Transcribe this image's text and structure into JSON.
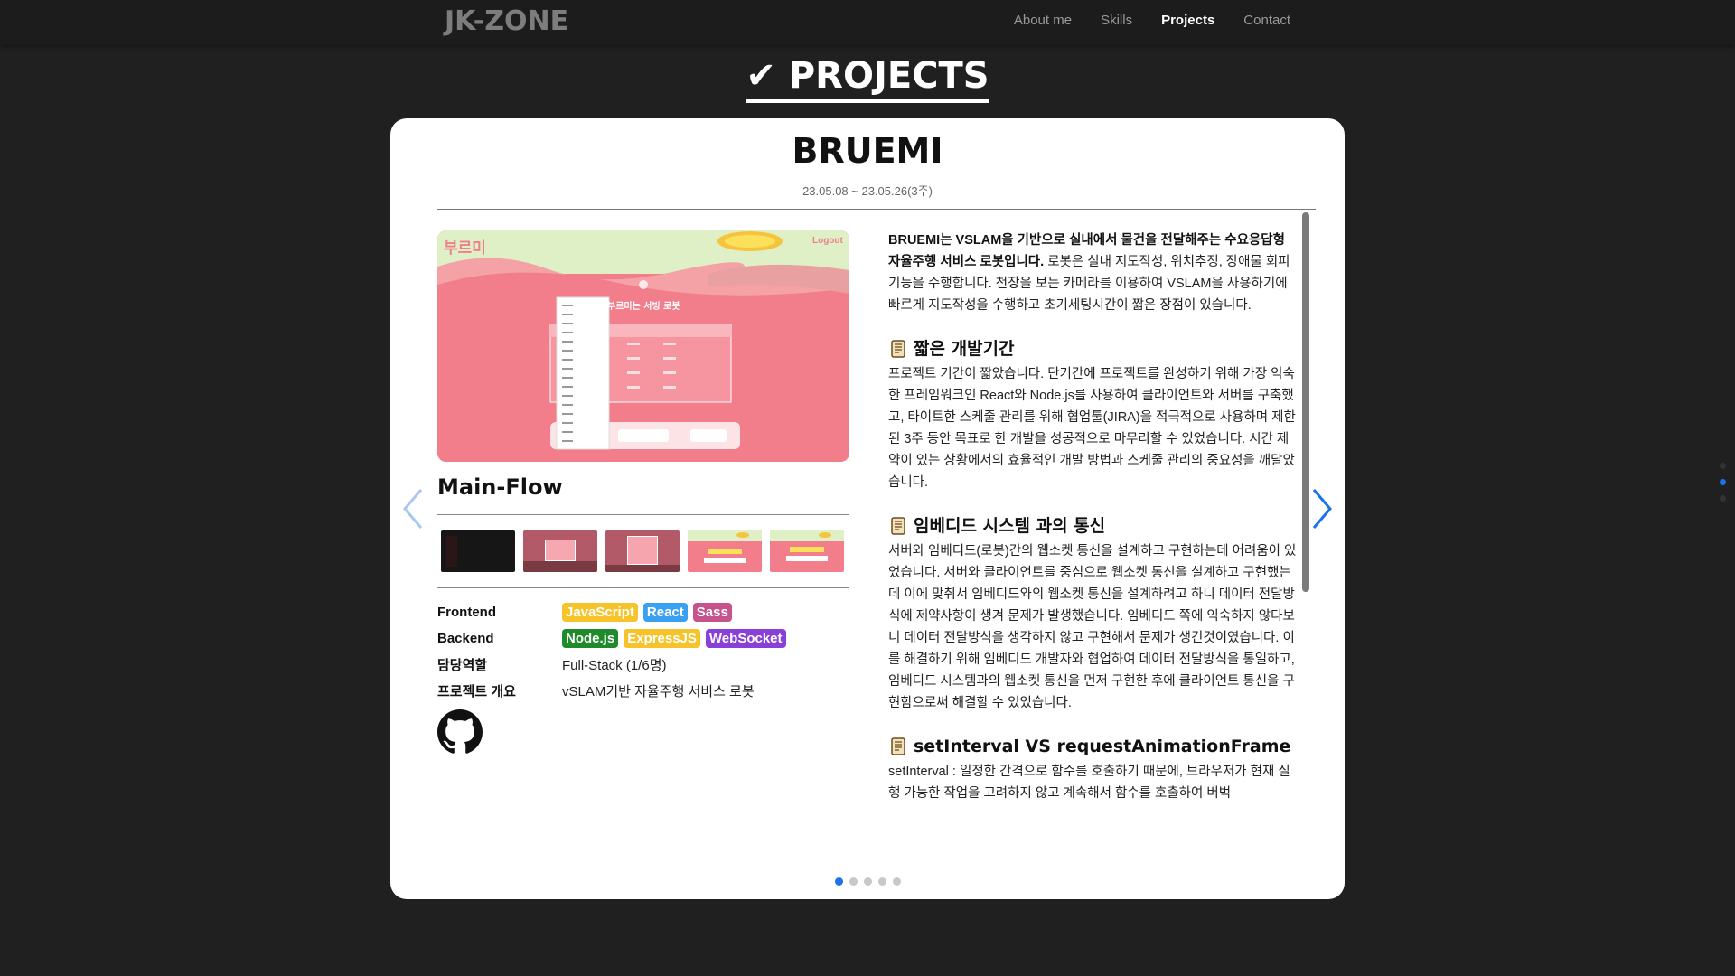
{
  "nav": {
    "logo": "JK-ZONE",
    "links": [
      {
        "label": "About me",
        "active": false
      },
      {
        "label": "Skills",
        "active": false
      },
      {
        "label": "Projects",
        "active": true
      },
      {
        "label": "Contact",
        "active": false
      }
    ]
  },
  "section_title": "✔ PROJECTS",
  "project": {
    "title": "BRUEMI",
    "date": "23.05.08 ~ 23.05.26(3주)",
    "screenshot": {
      "brand": "부르미",
      "logout": "Logout",
      "heading": "부르미는 서빙 로봇"
    },
    "caption": "Main-Flow",
    "info": {
      "frontend_label": "Frontend",
      "frontend_badges": [
        {
          "label": "JavaScript",
          "color": "#f7c32b"
        },
        {
          "label": "React",
          "color": "#3aa0f0"
        },
        {
          "label": "Sass",
          "color": "#c6538c"
        }
      ],
      "backend_label": "Backend",
      "backend_badges": [
        {
          "label": "Node.js",
          "color": "#1e8a2a"
        },
        {
          "label": "ExpressJS",
          "color": "#f7c32b"
        },
        {
          "label": "WebSocket",
          "color": "#8b3fd9"
        }
      ],
      "role_label": "담당역할",
      "role_value": "Full-Stack (1/6명)",
      "overview_label": "프로젝트 개요",
      "overview_value": "vSLAM기반 자율주행 서비스 로봇"
    },
    "description": {
      "intro_bold": "BRUEMI는 VSLAM을 기반으로 실내에서 물건을 전달해주는 수요응답형 자율주행 서비스 로봇입니다.",
      "intro_rest": " 로봇은 실내 지도작성, 위치추정, 장애물 회피 기능을 수행합니다. 천장을 보는 카메라를 이용하여 VSLAM을 사용하기에 빠르게 지도작성을 수행하고 초기세팅시간이 짧은 장점이 있습니다.",
      "sections": [
        {
          "title": "짧은 개발기간",
          "body": "프로젝트 기간이 짧았습니다. 단기간에 프로젝트를 완성하기 위해 가장 익숙한 프레임워크인 React와 Node.js를 사용하여 클라이언트와 서버를 구축했고, 타이트한 스케줄 관리를 위해 협업툴(JIRA)을 적극적으로 사용하며 제한된 3주 동안 목표로 한 개발을 성공적으로 마무리할 수 있었습니다. 시간 제약이 있는 상황에서의 효율적인 개발 방법과 스케줄 관리의 중요성을 깨달았습니다."
        },
        {
          "title": "임베디드 시스템 과의 통신",
          "body": "서버와 임베디드(로봇)간의 웹소켓 통신을 설계하고 구현하는데 어려움이 있었습니다. 서버와 클라이언트를 중심으로 웹소켓 통신을 설계하고 구현했는데 이에 맞춰서 임베디드와의 웹소켓 통신을 설계하려고 하니 데이터 전달방식에 제약사항이 생겨 문제가 발생했습니다. 임베디드 쪽에 익숙하지 않다보니 데이터 전달방식을 생각하지 않고 구현해서 문제가 생긴것이였습니다. 이를 해결하기 위해 임베디드 개발자와 협업하여 데이터 전달방식을 통일하고, 임베디드 시스템과의 웹소켓 통신을 먼저 구현한 후에 클라이언트 통신을 구현함으로써 해결할 수 있었습니다."
        },
        {
          "title": "setInterval VS requestAnimationFrame",
          "body": "setInterval : 일정한 간격으로 함수를 호출하기 때문에, 브라우저가 현재 실행 가능한 작업을 고려하지 않고 계속해서 함수를 호출하여 버벅"
        }
      ]
    },
    "slides": {
      "count": 5,
      "active": 0
    }
  },
  "colors": {
    "background": "#202020",
    "accent": "#1a73e8",
    "card": "#ffffff"
  }
}
